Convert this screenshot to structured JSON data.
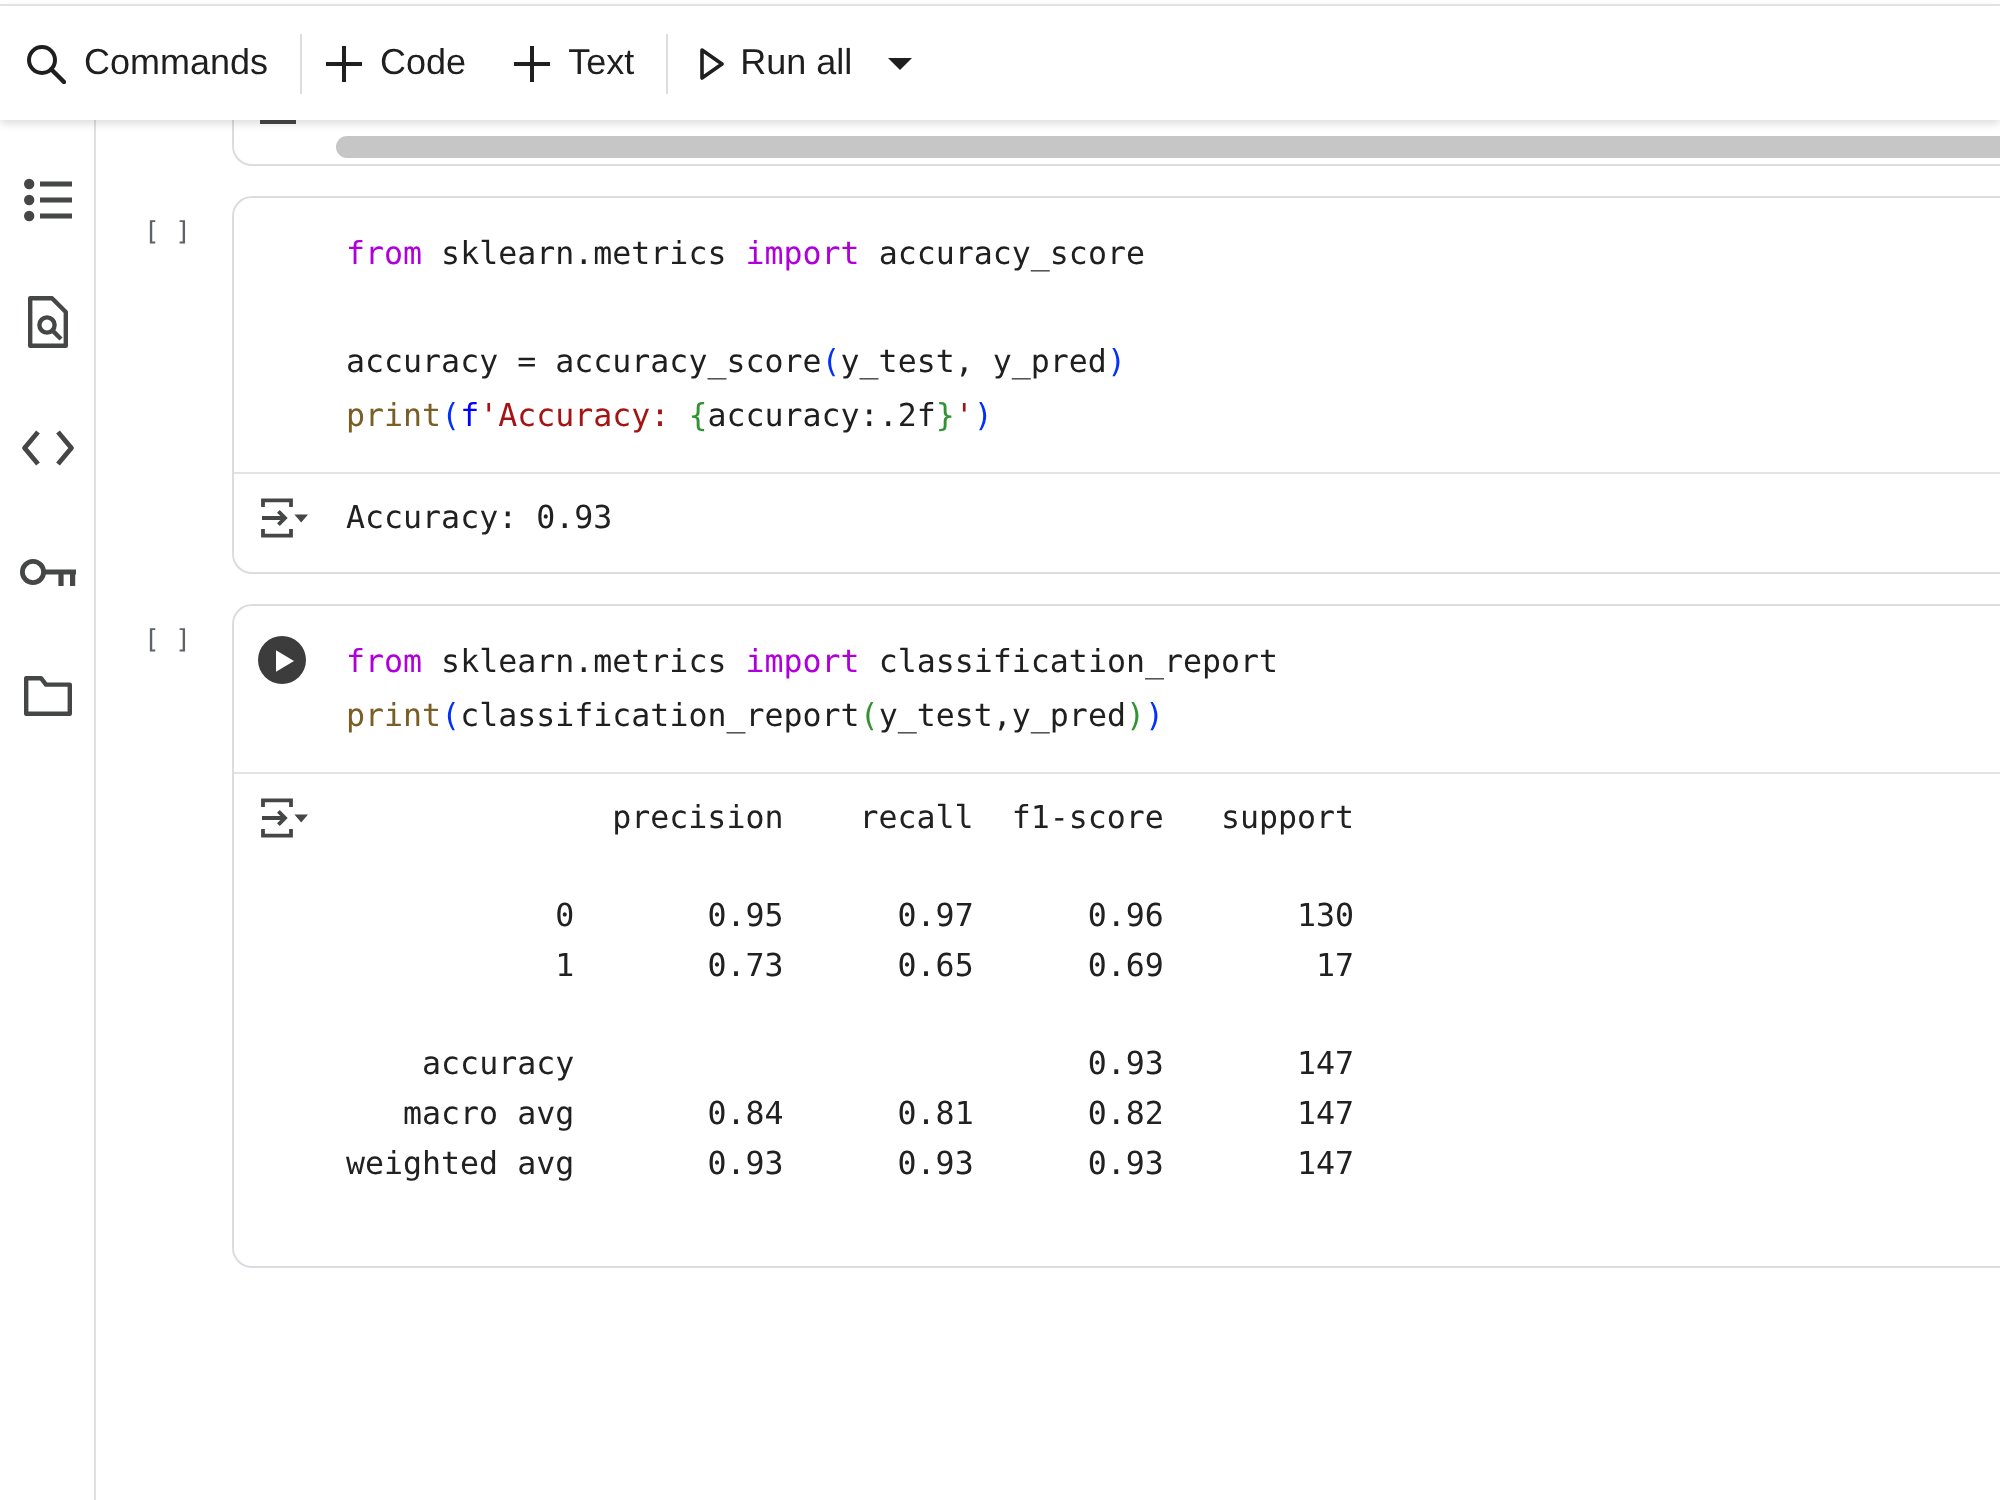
{
  "toolbar": {
    "groups": [
      {
        "items": [
          {
            "kind": "search",
            "label": "Commands"
          }
        ]
      },
      {
        "items": [
          {
            "kind": "add",
            "label": "Code"
          },
          {
            "kind": "add",
            "label": "Text"
          }
        ]
      },
      {
        "items": [
          {
            "kind": "run",
            "label": "Run all"
          },
          {
            "kind": "menu"
          }
        ]
      }
    ]
  },
  "cells": [
    {
      "execution_count": "[ ]",
      "run_button_shown": false,
      "code_blocks": [
        {
          "lines": [
            {
              "tokens": [
                {
                  "kind": "keyword",
                  "text": "from"
                },
                {
                  "kind": "plain",
                  "text": " sklearn.metrics "
                },
                {
                  "kind": "keyword",
                  "text": "import"
                },
                {
                  "kind": "plain",
                  "text": " accuracy_score"
                }
              ]
            }
          ]
        },
        {
          "lines": [
            {
              "tokens": [
                {
                  "kind": "plain",
                  "text": "accuracy = accuracy_score"
                },
                {
                  "kind": "bracket",
                  "text": "("
                },
                {
                  "kind": "plain",
                  "text": "y_test, y_pred"
                },
                {
                  "kind": "bracket",
                  "text": ")"
                }
              ]
            },
            {
              "tokens": [
                {
                  "kind": "builtin",
                  "text": "print"
                },
                {
                  "kind": "bracket",
                  "text": "("
                },
                {
                  "kind": "prefix",
                  "text": "f"
                },
                {
                  "kind": "string",
                  "text": "'Accuracy: "
                },
                {
                  "kind": "nested",
                  "text": "{"
                },
                {
                  "kind": "plain",
                  "text": "accuracy:.2f"
                },
                {
                  "kind": "nested",
                  "text": "}"
                },
                {
                  "kind": "string",
                  "text": "'"
                },
                {
                  "kind": "bracket",
                  "text": ")"
                }
              ]
            }
          ]
        }
      ],
      "output": {
        "kind": "text",
        "lines": [
          "Accuracy: 0.93"
        ]
      }
    },
    {
      "execution_count": "[ ]",
      "run_button_shown": true,
      "code_blocks": [
        {
          "lines": [
            {
              "tokens": [
                {
                  "kind": "keyword",
                  "text": "from"
                },
                {
                  "kind": "plain",
                  "text": " sklearn.metrics "
                },
                {
                  "kind": "keyword",
                  "text": "import"
                },
                {
                  "kind": "plain",
                  "text": " classification_report"
                }
              ]
            },
            {
              "tokens": [
                {
                  "kind": "builtin",
                  "text": "print"
                },
                {
                  "kind": "bracket",
                  "text": "("
                },
                {
                  "kind": "plain",
                  "text": "classification_report"
                },
                {
                  "kind": "nested",
                  "text": "("
                },
                {
                  "kind": "plain",
                  "text": "y_test,y_pred"
                },
                {
                  "kind": "nested",
                  "text": ")"
                },
                {
                  "kind": "bracket",
                  "text": ")"
                }
              ]
            }
          ]
        }
      ],
      "output": {
        "kind": "table",
        "columns": {
          "precision": "precision",
          "recall": "recall",
          "f1_score": "f1-score",
          "support": "support"
        },
        "row_groups": [
          {
            "rows": [
              {
                "label": "0",
                "precision": "0.95",
                "recall": "0.97",
                "f1_score": "0.96",
                "support": "130"
              },
              {
                "label": "1",
                "precision": "0.73",
                "recall": "0.65",
                "f1_score": "0.69",
                "support": "17"
              }
            ]
          },
          {
            "rows": [
              {
                "label": "accuracy",
                "f1_score": "0.93",
                "support": "147"
              },
              {
                "label": "macro avg",
                "precision": "0.84",
                "recall": "0.81",
                "f1_score": "0.82",
                "support": "147"
              },
              {
                "label": "weighted avg",
                "precision": "0.93",
                "recall": "0.93",
                "f1_score": "0.93",
                "support": "147"
              }
            ]
          }
        ]
      }
    }
  ]
}
